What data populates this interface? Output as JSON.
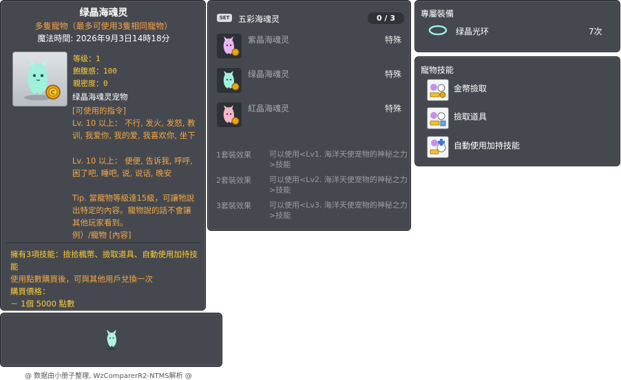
{
  "item_id": "05002707",
  "item": {
    "name": "绿晶海魂灵",
    "subtitle": "多隻寵物（最多可使用3隻相同寵物）",
    "expiry": "魔法時間: 2026年9月3日14時18分",
    "stats": {
      "level": "等级：1",
      "fullness": "飽腹感：100",
      "closeness": "親密度：0"
    },
    "pet_name": "绿晶海魂灵宠物",
    "commands_header": "[可使用的指令]",
    "cmd1": "Lv. 10 以上： 不行, 发火, 发怒, 教训, 我爱你, 我的爱, 我喜欢你, 坐下",
    "cmd2": "Lv. 10 以上： 便便, 告诉我, 呼呼, 困了吧, 睡吧, 说, 说话, 晚安",
    "tip": "Tip. 當寵物等級達15級，可讓牠說出特定的內容。寵物說的話不會讓其他玩家看到。",
    "example": "例）/寵物 [內容]",
    "skills_text": "擁有3項技能：撿拾楓幣、撿取道具、自動使用加持技能",
    "trade_note": "使用點數購買後，可與其他用戶兌換一次",
    "price_label": "購買價格：",
    "price_value": "－ 1個 5000 點數"
  },
  "footer": "@ 数据由小册子整理, WzComparerR2-NTMS解析 @",
  "set": {
    "badge": "SET",
    "title": "五彩海魂灵",
    "count": "0 / 3",
    "items": [
      {
        "name": "紫晶海魂灵",
        "type": "特殊"
      },
      {
        "name": "绿晶海魂灵",
        "type": "特殊"
      },
      {
        "name": "紅晶海魂灵",
        "type": "特殊"
      }
    ],
    "effects": [
      {
        "label": "1套裝效果",
        "text": "可以使用<Lv1. 海洋天使宠物的神秘之力>技能"
      },
      {
        "label": "2套裝效果",
        "text": "可以使用<Lv2. 海洋天使宠物的神秘之力>技能"
      },
      {
        "label": "3套裝效果",
        "text": "可以使用<Lv3. 海洋天使宠物的神秘之力>技能"
      }
    ]
  },
  "equip": {
    "header": "專屬裝備",
    "name": "绿晶光环",
    "count": "7次",
    "icon": "halo-ring-icon"
  },
  "pet_skills": {
    "header": "寵物技能",
    "items": [
      {
        "name": "金幣撿取",
        "icon": "meso-pickup-icon"
      },
      {
        "name": "撿取道具",
        "icon": "item-pickup-icon"
      },
      {
        "name": "自動使用加持技能",
        "icon": "auto-buff-icon"
      }
    ]
  },
  "colors": {
    "panel_bg": "#45494f",
    "orange": "#f5a644",
    "gold": "#ffcc33",
    "muted": "#9a9da2"
  }
}
